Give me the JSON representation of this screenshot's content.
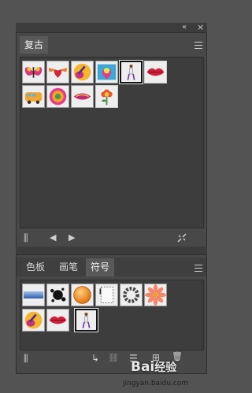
{
  "panel_top": {
    "collapse_glyph": "«",
    "close_glyph": "×",
    "tab_label": "复古",
    "menu_icon": "hamburger-icon",
    "symbols": [
      "butterfly",
      "winged-heart",
      "guitar",
      "peace-heart",
      "dancer",
      "lips",
      "vw-bus",
      "swirl-circle",
      "feather-wing",
      "flower"
    ],
    "selected_index": 4,
    "footer": {
      "libraries_glyph": "⫼",
      "prev_glyph": "◀",
      "next_glyph": "▶",
      "break_link_icon": "break-link-icon"
    }
  },
  "panel_bottom": {
    "tabs": [
      {
        "label": "色板",
        "active": false
      },
      {
        "label": "画笔",
        "active": false
      },
      {
        "label": "符号",
        "active": true
      }
    ],
    "menu_icon": "hamburger-icon",
    "symbols": [
      "blue-bar",
      "ink-splat",
      "orange-ball",
      "text-frame",
      "ring-cluster",
      "daisy",
      "guitar",
      "lips",
      "dancer"
    ],
    "selected_index": 8,
    "footer": {
      "libraries_glyph": "⫼",
      "place_glyph": "↳",
      "break_glyph": "⛓",
      "options_glyph": "☰",
      "new_glyph": "⊞",
      "delete_glyph": "🗑"
    }
  },
  "watermark": {
    "brand": "Bai",
    "brand_rest": "经验",
    "url": "jingyan.baidu.com"
  }
}
